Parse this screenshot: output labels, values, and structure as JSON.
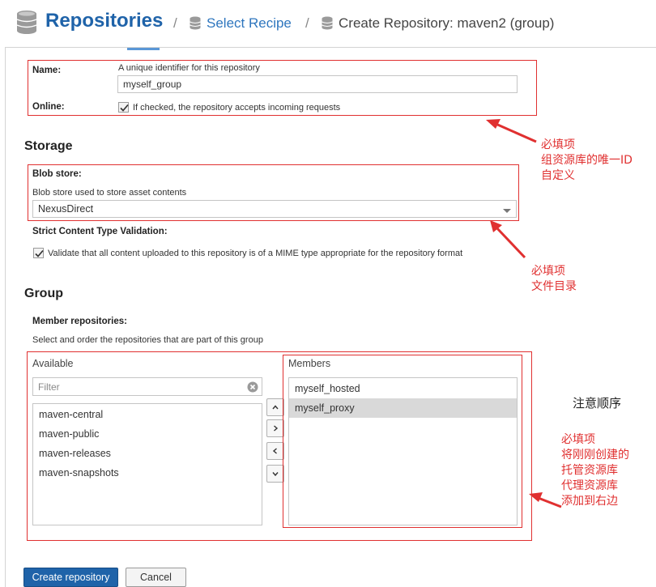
{
  "header": {
    "title": "Repositories",
    "separator": "/",
    "crumb_select_recipe": "Select Recipe",
    "crumb_current": "Create Repository: maven2 (group)"
  },
  "name_field": {
    "label": "Name:",
    "hint": "A unique identifier for this repository",
    "value": "myself_group"
  },
  "online_field": {
    "label": "Online:",
    "checked": true,
    "hint": "If checked, the repository accepts incoming requests"
  },
  "storage": {
    "section_title": "Storage",
    "blob_label": "Blob store:",
    "blob_hint": "Blob store used to store asset contents",
    "blob_value": "NexusDirect",
    "strict_label": "Strict Content Type Validation:",
    "strict_checked": true,
    "strict_hint": "Validate that all content uploaded to this repository is of a MIME type appropriate for the repository format"
  },
  "group": {
    "section_title": "Group",
    "members_label": "Member repositories:",
    "members_hint": "Select and order the repositories that are part of this group",
    "available_title": "Available",
    "filter_placeholder": "Filter",
    "available_items": [
      "maven-central",
      "maven-public",
      "maven-releases",
      "maven-snapshots"
    ],
    "members_title": "Members",
    "member_items": [
      "myself_hosted",
      "myself_proxy"
    ],
    "selected_member_index": 1
  },
  "buttons": {
    "create": "Create repository",
    "cancel": "Cancel"
  },
  "annotations": {
    "note1": "必填项\n组资源库的唯一ID\n自定义",
    "note2": "必填项\n文件目录",
    "note_order": "注意顺序",
    "note3": "必填项\n将刚刚创建的\n托管资源库\n代理资源库\n添加到右边"
  },
  "colors": {
    "brand_blue": "#1f63a9",
    "annotation_red": "#e03030"
  }
}
